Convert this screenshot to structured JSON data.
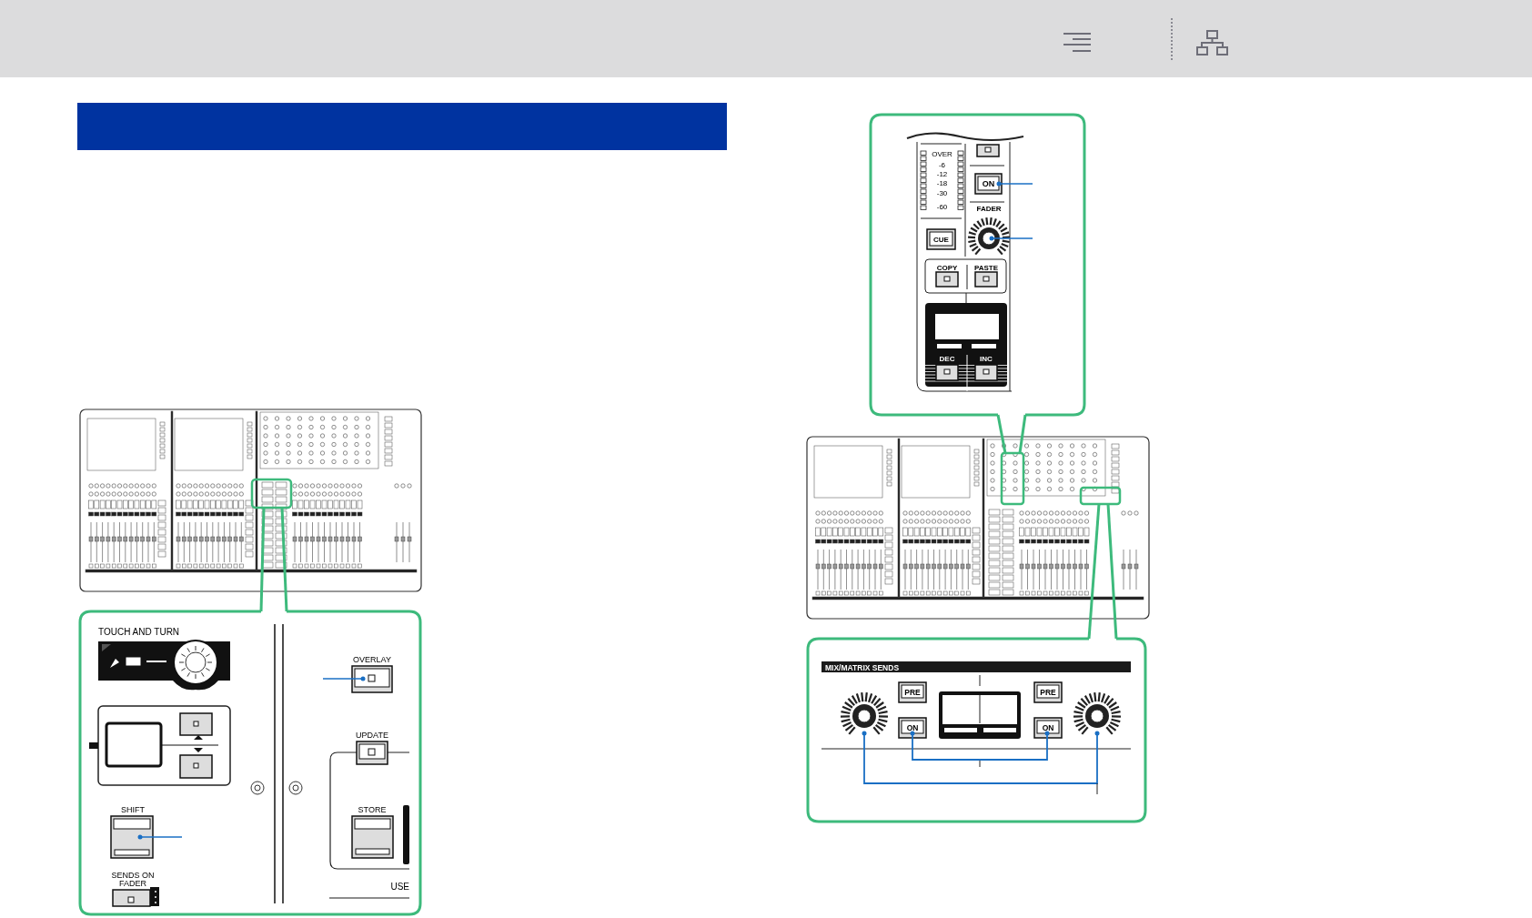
{
  "left_detail": {
    "touch_and_turn": "TOUCH AND TURN",
    "overlay": "OVERLAY",
    "update": "UPDATE",
    "store": "STORE",
    "use": "USE",
    "shift": "SHIFT",
    "sends_on_fader": [
      "SENDS ON",
      "FADER"
    ]
  },
  "channel_detail": {
    "meter_scale": [
      "OVER",
      "-6",
      "-12",
      "-18",
      "-30",
      "-60"
    ],
    "on": "ON",
    "fader": "FADER",
    "cue": "CUE",
    "copy": "COPY",
    "paste": "PASTE",
    "dec": "DEC",
    "inc": "INC"
  },
  "sends_detail": {
    "title": "MIX/MATRIX SENDS",
    "buttons": [
      {
        "label": "PRE"
      },
      {
        "label": "ON"
      },
      {
        "label": "PRE"
      },
      {
        "label": "ON"
      }
    ]
  }
}
